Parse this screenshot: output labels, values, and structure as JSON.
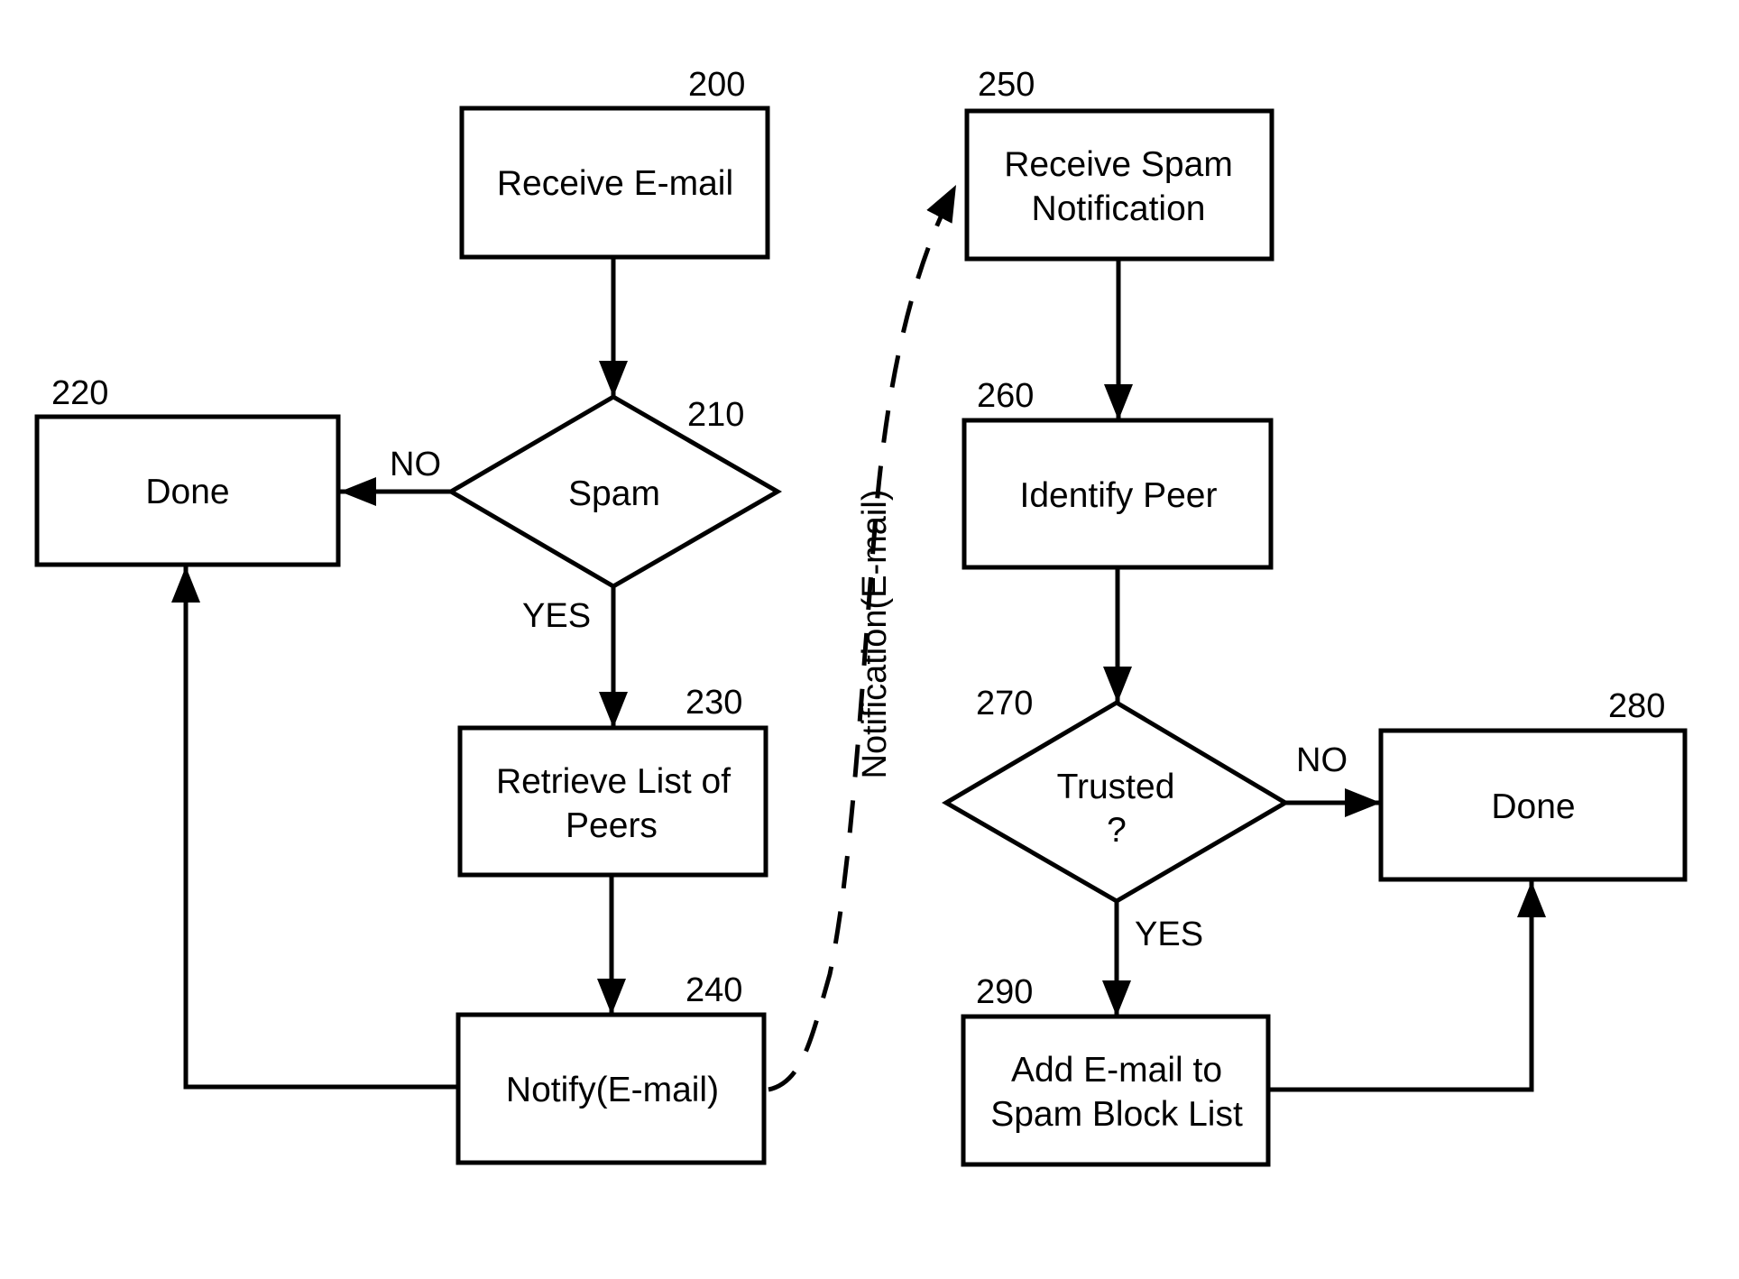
{
  "diagram": {
    "type": "flowchart",
    "nodes": {
      "n200": {
        "ref": "200",
        "shape": "process",
        "lines": [
          "Receive E-mail"
        ]
      },
      "n210": {
        "ref": "210",
        "shape": "decision",
        "lines": [
          "Spam"
        ]
      },
      "n220": {
        "ref": "220",
        "shape": "process",
        "lines": [
          "Done"
        ]
      },
      "n230": {
        "ref": "230",
        "shape": "process",
        "lines": [
          "Retrieve List of",
          "Peers"
        ]
      },
      "n240": {
        "ref": "240",
        "shape": "process",
        "lines": [
          "Notify(E-mail)"
        ]
      },
      "n250": {
        "ref": "250",
        "shape": "process",
        "lines": [
          "Receive Spam",
          "Notification"
        ]
      },
      "n260": {
        "ref": "260",
        "shape": "process",
        "lines": [
          "Identify Peer"
        ]
      },
      "n270": {
        "ref": "270",
        "shape": "decision",
        "lines": [
          "Trusted",
          "?"
        ]
      },
      "n280": {
        "ref": "280",
        "shape": "process",
        "lines": [
          "Done"
        ]
      },
      "n290": {
        "ref": "290",
        "shape": "process",
        "lines": [
          "Add E-mail to",
          "Spam Block List"
        ]
      }
    },
    "edges": {
      "e200_210": {
        "from": "200",
        "to": "210",
        "label": ""
      },
      "e210_220": {
        "from": "210",
        "to": "220",
        "label": "NO"
      },
      "e210_230": {
        "from": "210",
        "to": "230",
        "label": "YES"
      },
      "e230_240": {
        "from": "230",
        "to": "240",
        "label": ""
      },
      "e240_220": {
        "from": "240",
        "to": "220",
        "label": ""
      },
      "e240_250": {
        "from": "240",
        "to": "250",
        "label": "Notification(E-mail)",
        "style": "dashed"
      },
      "e250_260": {
        "from": "250",
        "to": "260",
        "label": ""
      },
      "e260_270": {
        "from": "260",
        "to": "270",
        "label": ""
      },
      "e270_280": {
        "from": "270",
        "to": "280",
        "label": "NO"
      },
      "e270_290": {
        "from": "270",
        "to": "290",
        "label": "YES"
      },
      "e290_280": {
        "from": "290",
        "to": "280",
        "label": ""
      }
    }
  }
}
